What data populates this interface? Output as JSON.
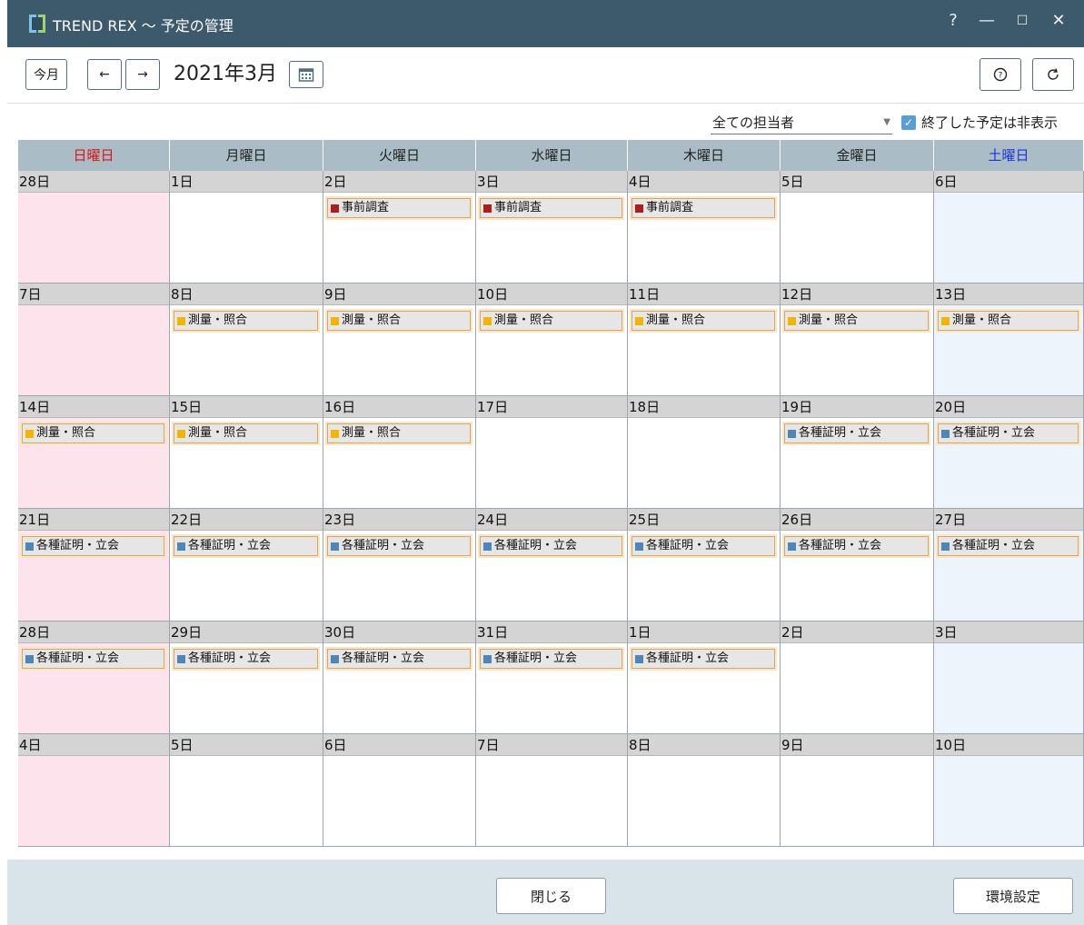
{
  "window": {
    "title": "TREND REX ～ 予定の管理",
    "controls": [
      "?",
      "—",
      "☐",
      "✕"
    ]
  },
  "toolbar": {
    "today_label": "今月",
    "prev_label": "←",
    "next_label": "→",
    "month_label": "2021年3月",
    "help_icon": "help-icon",
    "refresh_icon": "refresh-icon"
  },
  "filter": {
    "assignee_value": "全ての担当者",
    "hide_done_label": "終了した予定は非表示",
    "hide_done_checked": true
  },
  "calendar": {
    "weekdays": [
      "日曜日",
      "月曜日",
      "火曜日",
      "水曜日",
      "木曜日",
      "金曜日",
      "土曜日"
    ],
    "weeks": [
      [
        {
          "day": "28日",
          "event": null
        },
        {
          "day": "1日",
          "event": null
        },
        {
          "day": "2日",
          "event": "事前調査"
        },
        {
          "day": "3日",
          "event": "事前調査"
        },
        {
          "day": "4日",
          "event": "事前調査"
        },
        {
          "day": "5日",
          "event": null
        },
        {
          "day": "6日",
          "event": null
        }
      ],
      [
        {
          "day": "7日",
          "event": null
        },
        {
          "day": "8日",
          "event": "測量・照合"
        },
        {
          "day": "9日",
          "event": "測量・照合"
        },
        {
          "day": "10日",
          "event": "測量・照合"
        },
        {
          "day": "11日",
          "event": "測量・照合"
        },
        {
          "day": "12日",
          "event": "測量・照合"
        },
        {
          "day": "13日",
          "event": "測量・照合"
        }
      ],
      [
        {
          "day": "14日",
          "event": "測量・照合"
        },
        {
          "day": "15日",
          "event": "測量・照合"
        },
        {
          "day": "16日",
          "event": "測量・照合"
        },
        {
          "day": "17日",
          "event": null
        },
        {
          "day": "18日",
          "event": null
        },
        {
          "day": "19日",
          "event": "各種証明・立会"
        },
        {
          "day": "20日",
          "event": "各種証明・立会"
        }
      ],
      [
        {
          "day": "21日",
          "event": "各種証明・立会"
        },
        {
          "day": "22日",
          "event": "各種証明・立会"
        },
        {
          "day": "23日",
          "event": "各種証明・立会"
        },
        {
          "day": "24日",
          "event": "各種証明・立会"
        },
        {
          "day": "25日",
          "event": "各種証明・立会"
        },
        {
          "day": "26日",
          "event": "各種証明・立会"
        },
        {
          "day": "27日",
          "event": "各種証明・立会"
        }
      ],
      [
        {
          "day": "28日",
          "event": "各種証明・立会"
        },
        {
          "day": "29日",
          "event": "各種証明・立会"
        },
        {
          "day": "30日",
          "event": "各種証明・立会"
        },
        {
          "day": "31日",
          "event": "各種証明・立会"
        },
        {
          "day": "1日",
          "event": "各種証明・立会"
        },
        {
          "day": "2日",
          "event": null
        },
        {
          "day": "3日",
          "event": null
        }
      ],
      [
        {
          "day": "4日",
          "event": null
        },
        {
          "day": "5日",
          "event": null
        },
        {
          "day": "6日",
          "event": null
        },
        {
          "day": "7日",
          "event": null
        },
        {
          "day": "8日",
          "event": null
        },
        {
          "day": "9日",
          "event": null
        },
        {
          "day": "10日",
          "event": null
        }
      ]
    ],
    "event_colors": {
      "事前調査": "#b01c1c",
      "測量・照合": "#f2b600",
      "各種証明・立会": "#4f86b8"
    }
  },
  "footer": {
    "close_label": "閉じる",
    "settings_label": "環境設定"
  }
}
